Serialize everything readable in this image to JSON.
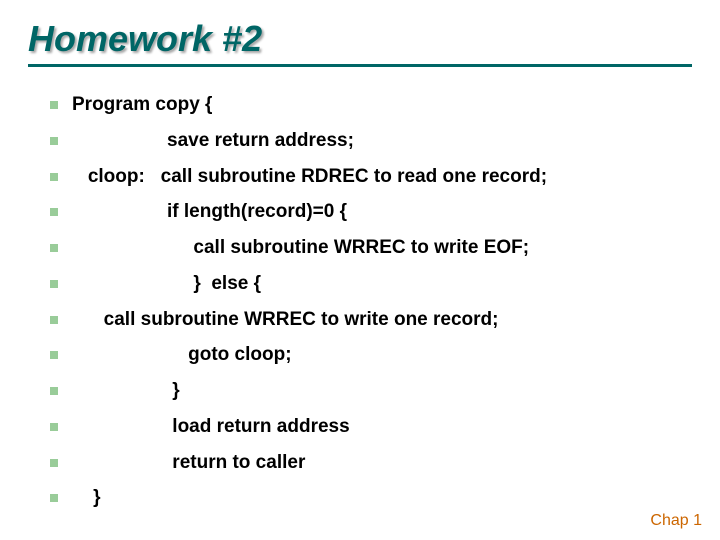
{
  "title": "Homework #2",
  "lines": [
    "Program copy {",
    "                  save return address;",
    "   cloop:   call subroutine RDREC to read one record;",
    "                  if length(record)=0 {",
    "                       call subroutine WRREC to write EOF;",
    "                       }  else {",
    "      call subroutine WRREC to write one record;",
    "                      goto cloop;",
    "                   }",
    "                   load return address",
    "                   return to caller",
    "    }"
  ],
  "footer": "Chap 1"
}
